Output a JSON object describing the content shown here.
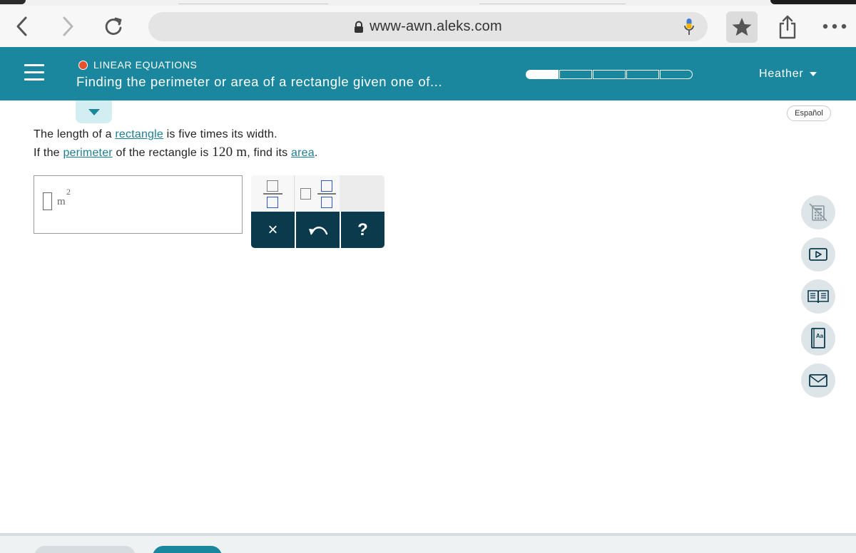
{
  "browser": {
    "url": "www-awn.aleks.com"
  },
  "header": {
    "topic": "LINEAR EQUATIONS",
    "title": "Finding the perimeter or area of a rectangle given one of...",
    "progress": {
      "filled": 1,
      "total": 5
    },
    "user": "Heather",
    "colors": {
      "bar": "#1a879e",
      "topic_dot": "#e8512e"
    }
  },
  "language_button": "Español",
  "problem": {
    "line1_pre": "The length of a ",
    "line1_link": "rectangle",
    "line1_post": " is five times its width.",
    "line2_pre": "If the ",
    "line2_link1": "perimeter",
    "line2_mid1": " of the rectangle is ",
    "line2_value": "120 m",
    "line2_mid2": ", find its ",
    "line2_link2": "area",
    "line2_end": "."
  },
  "answer": {
    "unit": "m",
    "exponent": "2"
  },
  "keypad": {
    "clear": "×",
    "help": "?"
  },
  "tools": [
    "calculator-icon",
    "video-icon",
    "ebook-icon",
    "dictionary-icon",
    "message-icon"
  ]
}
